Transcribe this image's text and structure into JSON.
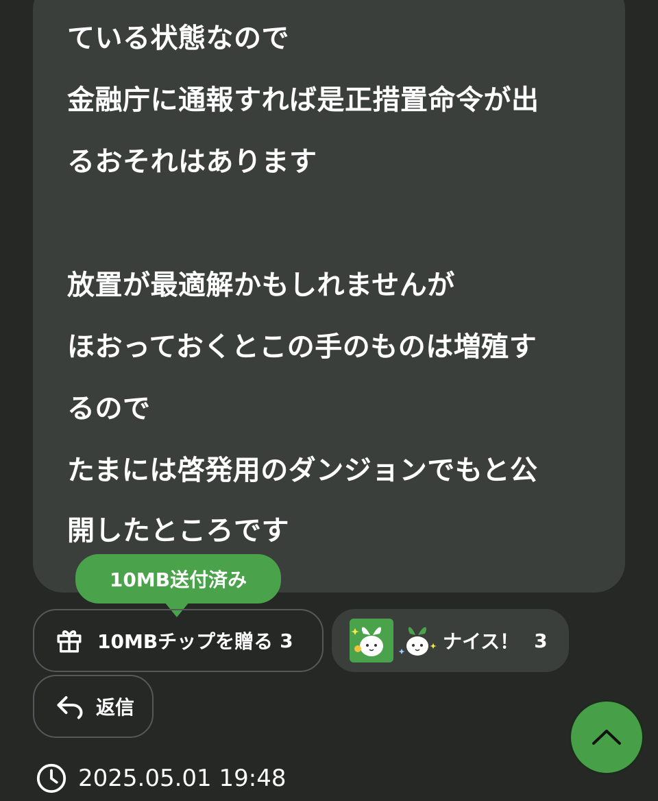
{
  "message": {
    "lines": [
      "ている状態なので",
      "金融庁に通報すれば是正措置命令が出",
      "るおそれはあります",
      "",
      "放置が最適解かもしれませんが",
      "ほおっておくとこの手のものは増殖す",
      "るので",
      "たまには啓発用のダンジョンでもと公",
      "開したところです"
    ]
  },
  "tip_tooltip": "10MB送付済み",
  "tip_button": {
    "label": "10MBチップを贈る",
    "count": "3",
    "icon": "gift-icon"
  },
  "reaction": {
    "label": "ナイス！",
    "count": "3",
    "accent": "#4aa24a"
  },
  "reply_button": {
    "label": "返信",
    "icon": "reply-icon"
  },
  "timestamp": "2025.05.01 19:48",
  "colors": {
    "background": "#262826",
    "bubble": "#3b3f3b",
    "accent": "#4aa24a"
  }
}
